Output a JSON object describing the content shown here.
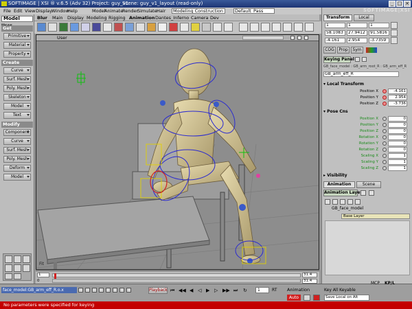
{
  "titlebar": {
    "app": "SOFTIMAGE | XSI ® v.6.5 (Adv 32) Project: guy_v1",
    "scene": "Scene: guy_v1_layout (read-only)"
  },
  "menubar": {
    "items": [
      "File",
      "Edit",
      "View",
      "Display",
      "Window",
      "Help",
      "Model",
      "Animate",
      "Render",
      "Simulate",
      "Hair"
    ],
    "layout_dropdown": "Modeling Construction Mode",
    "pass_dropdown": "Default_Pass"
  },
  "toolbar2": {
    "items": [
      "Blur",
      "Main",
      "Display",
      "Modeling",
      "Rigging",
      "Animation",
      "Dantes_Inferno",
      "Camera",
      "Dev"
    ]
  },
  "leftpanel": {
    "mode": "Model",
    "user_label": "User",
    "sections": [
      {
        "header": "Get",
        "buttons": [
          "Primitive",
          "Material",
          "Property"
        ]
      },
      {
        "header": "Create",
        "buttons": [
          "Curve",
          "Surf. Mesh",
          "Poly. Mesh",
          "Skeleton",
          "Model",
          "Text"
        ]
      },
      {
        "header": "Modify",
        "buttons": [
          "Component",
          "Curve",
          "Surf. Mesh",
          "Poly. Mesh",
          "Deform",
          "Model"
        ]
      }
    ]
  },
  "viewport": {
    "camera": "User",
    "bottom_label": "Fit"
  },
  "rightpanel": {
    "watermark": "SOFTIMAGE|XSI",
    "transform_tab": "Transform",
    "space": "Local",
    "scale": [
      "1",
      "1",
      "1"
    ],
    "rotate": [
      "58.1083",
      "27.9412",
      "91.5816"
    ],
    "translate": [
      "-4.161",
      "2.954",
      "-3.7359"
    ],
    "toggles": [
      "COG",
      "Prop",
      "Sym"
    ],
    "keying_panel": "Keying Panel",
    "breadcrumb": "GB_face_model : GB_arm_root_R : GB_arm_eff_R",
    "object_name": "GB_arm_eff_R",
    "local_transform": {
      "header": "Local Transform",
      "rows": [
        {
          "label": "Position X",
          "value": "-4.161"
        },
        {
          "label": "Position Y",
          "value": "2.954"
        },
        {
          "label": "Position Z",
          "value": "-3.736"
        }
      ]
    },
    "pose": {
      "header": "Pose Cns",
      "rows": [
        {
          "label": "Position X",
          "value": "0"
        },
        {
          "label": "Position Y",
          "value": "0"
        },
        {
          "label": "Position Z",
          "value": "0"
        },
        {
          "label": "Rotation X",
          "value": "0"
        },
        {
          "label": "Rotation Y",
          "value": "0"
        },
        {
          "label": "Rotation Z",
          "value": "0"
        },
        {
          "label": "Scaling X",
          "value": "1"
        },
        {
          "label": "Scaling Y",
          "value": "1"
        },
        {
          "label": "Scaling Z",
          "value": "1"
        }
      ]
    },
    "visibility": "Visibility",
    "tabs": [
      "Animation",
      "Scene"
    ],
    "animation_layers": "Animation Layers",
    "layer_item": "GB_face_model",
    "base_layer": "Base Layer"
  },
  "timeline": {
    "start": "1",
    "end": "31.4",
    "end2": "31.4",
    "current": "0"
  },
  "bottombar": {
    "selection": "face_model:GB_arm_eff_R.o.x",
    "playback": "Playback",
    "frame": "1",
    "rt": "RT",
    "animation_label": "Animation",
    "auto_label": "Auto",
    "key_label": "Key All Keyable",
    "key_mode": "Save Local on Alt",
    "mcp": "MCP",
    "kp_l": "KP/L"
  },
  "status": "No parameters were specified for keying"
}
